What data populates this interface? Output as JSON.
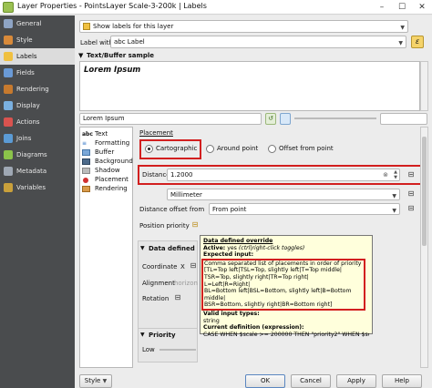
{
  "window": {
    "title": "Layer Properties - PointsLayer Scale-3-200k | Labels"
  },
  "sidebar": {
    "items": [
      {
        "label": "General",
        "color": "#8ea4c4"
      },
      {
        "label": "Style",
        "color": "#d88a3a"
      },
      {
        "label": "Labels",
        "color": "#f0c040"
      },
      {
        "label": "Fields",
        "color": "#6a9ad6"
      },
      {
        "label": "Rendering",
        "color": "#c77a2e"
      },
      {
        "label": "Display",
        "color": "#7ab0e0"
      },
      {
        "label": "Actions",
        "color": "#d9534f"
      },
      {
        "label": "Joins",
        "color": "#5b9bd5"
      },
      {
        "label": "Diagrams",
        "color": "#8bc34a"
      },
      {
        "label": "Metadata",
        "color": "#9fa8b4"
      },
      {
        "label": "Variables",
        "color": "#c9a03b"
      }
    ]
  },
  "labels_mode": {
    "value": "Show labels for this layer"
  },
  "label_with": {
    "label": "Label with",
    "value": "abc Label"
  },
  "sample": {
    "heading": "Text/Buffer sample",
    "text": "Lorem Ipsum",
    "input": "Lorem Ipsum"
  },
  "tabs": [
    {
      "label": "Text"
    },
    {
      "label": "Formatting"
    },
    {
      "label": "Buffer"
    },
    {
      "label": "Background"
    },
    {
      "label": "Shadow"
    },
    {
      "label": "Placement"
    },
    {
      "label": "Rendering"
    }
  ],
  "placement": {
    "heading": "Placement",
    "options": [
      "Cartographic",
      "Around point",
      "Offset from point"
    ],
    "distance_label": "Distance",
    "distance_value": "1.2000",
    "unit": "Millimeter",
    "offset_from_label": "Distance offset from",
    "offset_from_value": "From point",
    "position_priority_label": "Position priority",
    "data_defined_heading": "Data defined",
    "coordinate_label": "Coordinate",
    "coordinate_x": "X",
    "alignment_label": "Alignment",
    "alignment_value": "horizon",
    "rotation_label": "Rotation",
    "priority_heading": "Priority",
    "priority_low": "Low"
  },
  "tooltip": {
    "title": "Data defined override",
    "active_label": "Active:",
    "active_value": "yes",
    "active_hint": "(ctrl|right-click toggles)",
    "expected_label": "Expected input:",
    "lines": [
      "Comma separated list of placements in order of priority",
      "[TL=Top left|TSL=Top, slightly left|T=Top middle|",
      "TSR=Top, slightly right|TR=Top right|",
      "L=Left|R=Right|",
      "BL=Bottom left|BSL=Bottom, slightly left|B=Bottom middle|",
      "BSR=Bottom, slightly right|BR=Bottom right]"
    ],
    "valid_types_label": "Valid input types:",
    "valid_types_value": "string",
    "current_label": "Current definition (expression):",
    "current_value": "CASE WHEN $scale >= 200000 THEN \"priority2\" WHEN $scale"
  },
  "footer": {
    "style_button": "Style",
    "ok": "OK",
    "cancel": "Cancel",
    "apply": "Apply",
    "help": "Help"
  }
}
